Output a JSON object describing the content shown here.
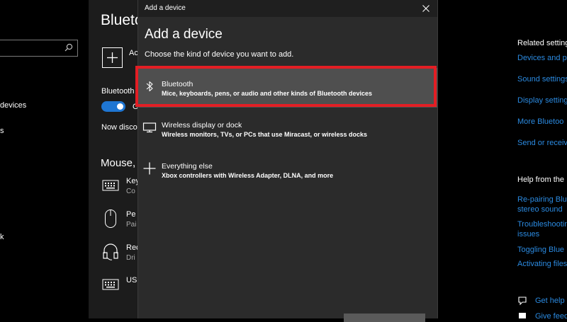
{
  "left_pane": {
    "item1": "devices",
    "item2": "s",
    "item3": "k"
  },
  "mid_pane": {
    "title": "Blueto",
    "add_label": "Ac",
    "bluetooth_label": "Bluetooth",
    "toggle_state": "O",
    "discover_text": "Now disco",
    "section": "Mouse,",
    "devices": [
      {
        "name": "Key",
        "sub": "Co"
      },
      {
        "name": "Pe",
        "sub": "Pai"
      },
      {
        "name": "Rec",
        "sub": "Dri"
      },
      {
        "name": "USI",
        "sub": ""
      }
    ]
  },
  "dialog": {
    "window_title": "Add a device",
    "heading": "Add a device",
    "subtitle": "Choose the kind of device you want to add.",
    "options": [
      {
        "label": "Bluetooth",
        "desc": "Mice, keyboards, pens, or audio and other kinds of Bluetooth devices",
        "icon": "bluetooth-icon"
      },
      {
        "label": "Wireless display or dock",
        "desc": "Wireless monitors, TVs, or PCs that use Miracast, or wireless docks",
        "icon": "monitor-icon"
      },
      {
        "label": "Everything else",
        "desc": "Xbox controllers with Wireless Adapter, DLNA, and more",
        "icon": "plus-icon"
      }
    ]
  },
  "right_pane": {
    "related_heading": "Related setting",
    "related_links": [
      "Devices and pr",
      "Sound settings",
      "Display setting",
      "More Bluetoo",
      "Send or receiv"
    ],
    "help_heading": "Help from the",
    "help_links": [
      "Re-pairing Blue",
      "stereo sound",
      "Troubleshootin",
      "issues",
      "Toggling Blue",
      "Activating files"
    ],
    "get_help": "Get help",
    "give_feedback": "Give feed"
  },
  "colors": {
    "accent": "#2b8ae0",
    "highlight": "#e31e24",
    "dialog_bg": "#2b2b2b",
    "selected_bg": "#4f4f4f"
  }
}
